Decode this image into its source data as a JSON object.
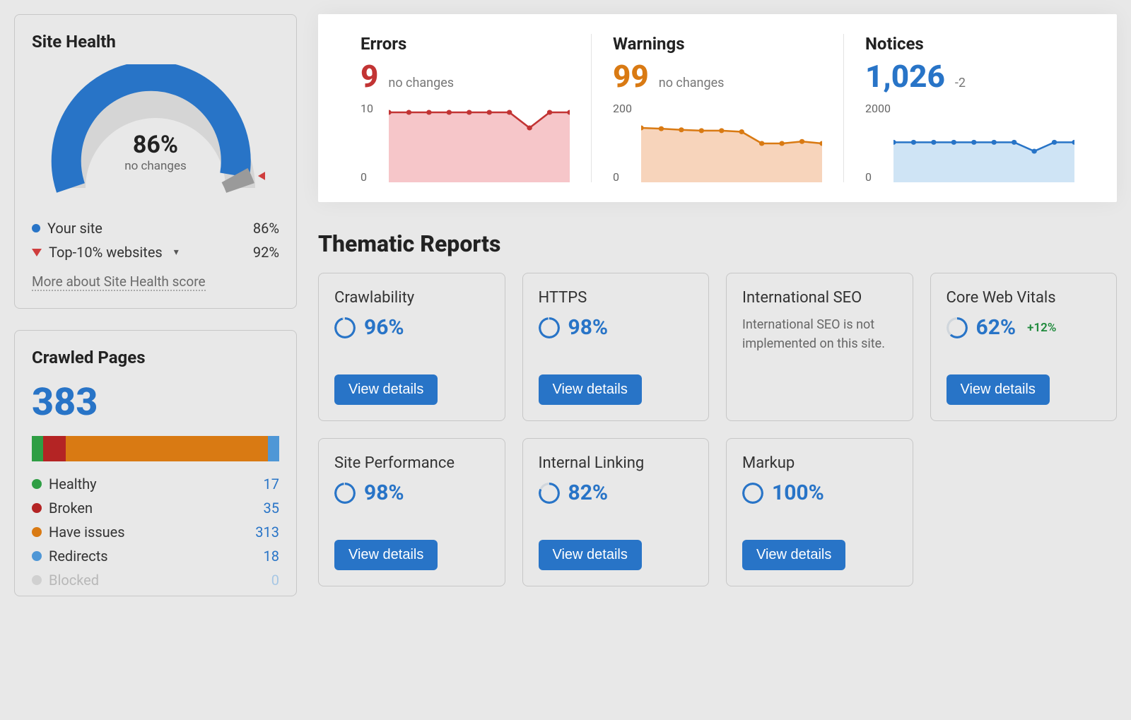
{
  "site_health": {
    "title": "Site Health",
    "percent_label": "86%",
    "sub_label": "no changes",
    "gauge_value": 86,
    "legend": {
      "your_site": {
        "label": "Your site",
        "value": "86%"
      },
      "top10": {
        "label": "Top-10% websites",
        "value": "92%"
      }
    },
    "more_link": "More about Site Health score"
  },
  "crawled_pages": {
    "title": "Crawled Pages",
    "total": "383",
    "segments": [
      {
        "label": "Healthy",
        "value": 17,
        "color": "#2f9e44"
      },
      {
        "label": "Broken",
        "value": 35,
        "color": "#b42424"
      },
      {
        "label": "Have issues",
        "value": 313,
        "color": "#d97a13"
      },
      {
        "label": "Redirects",
        "value": 18,
        "color": "#4f97d6"
      },
      {
        "label": "Blocked",
        "value": 0,
        "color": "#d0d0d0"
      }
    ]
  },
  "metrics": {
    "errors": {
      "title": "Errors",
      "value": "9",
      "delta": "no changes",
      "ymax": "10",
      "ymin": "0",
      "color": "#c23434",
      "fill": "#f6c6c9"
    },
    "warnings": {
      "title": "Warnings",
      "value": "99",
      "delta": "no changes",
      "ymax": "200",
      "ymin": "0",
      "color": "#d97a13",
      "fill": "#f7d4bb"
    },
    "notices": {
      "title": "Notices",
      "value": "1,026",
      "delta": "-2",
      "ymax": "2000",
      "ymin": "0",
      "color": "#2874c7",
      "fill": "#cfe4f5"
    }
  },
  "thematic": {
    "title": "Thematic Reports",
    "view_details": "View details",
    "cards": [
      {
        "title": "Crawlability",
        "percent": "96%",
        "ring": 96
      },
      {
        "title": "HTTPS",
        "percent": "98%",
        "ring": 98
      },
      {
        "title": "International SEO",
        "note": "International SEO is not implemented on this site."
      },
      {
        "title": "Core Web Vitals",
        "percent": "62%",
        "ring": 62,
        "delta": "+12%"
      },
      {
        "title": "Site Performance",
        "percent": "98%",
        "ring": 98
      },
      {
        "title": "Internal Linking",
        "percent": "82%",
        "ring": 82
      },
      {
        "title": "Markup",
        "percent": "100%",
        "ring": 100
      }
    ]
  },
  "chart_data": [
    {
      "type": "area",
      "title": "Errors",
      "x": [
        1,
        2,
        3,
        4,
        5,
        6,
        7,
        8,
        9,
        10
      ],
      "values": [
        9,
        9,
        9,
        9,
        9,
        9,
        9,
        7,
        9,
        9
      ],
      "ylim": [
        0,
        10
      ]
    },
    {
      "type": "area",
      "title": "Warnings",
      "x": [
        1,
        2,
        3,
        4,
        5,
        6,
        7,
        8,
        9,
        10
      ],
      "values": [
        140,
        138,
        135,
        133,
        133,
        130,
        100,
        100,
        105,
        100
      ],
      "ylim": [
        0,
        200
      ]
    },
    {
      "type": "area",
      "title": "Notices",
      "x": [
        1,
        2,
        3,
        4,
        5,
        6,
        7,
        8,
        9,
        10
      ],
      "values": [
        1030,
        1030,
        1030,
        1030,
        1030,
        1030,
        1030,
        800,
        1030,
        1030
      ],
      "ylim": [
        0,
        2000
      ]
    }
  ]
}
